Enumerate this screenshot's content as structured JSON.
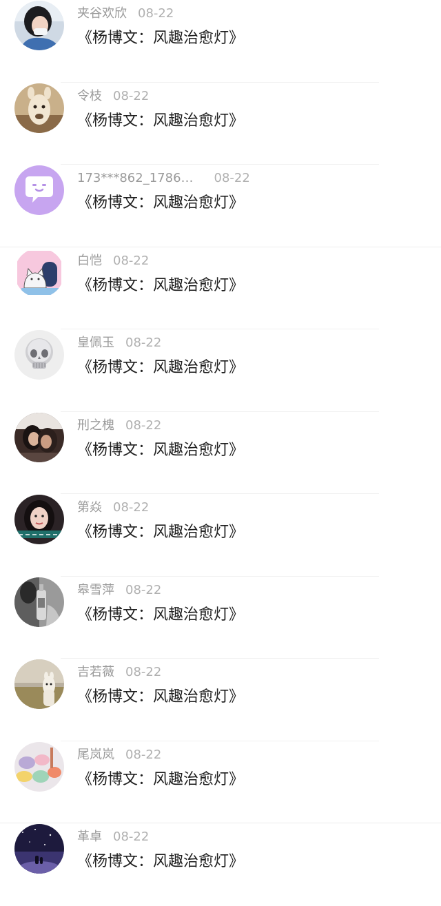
{
  "comments": [
    {
      "username": "夹谷欢欣",
      "date": "08-22",
      "title": "《杨博文：风趣治愈灯》",
      "avatar_icon": "girl-with-mask-avatar"
    },
    {
      "username": "令枝",
      "date": "08-22",
      "title": "《杨博文：风趣治愈灯》",
      "avatar_icon": "alpaca-avatar"
    },
    {
      "username": "173***862_1786…",
      "date": "08-22",
      "title": "《杨博文：风趣治愈灯》",
      "avatar_icon": "default-chat-bubble-avatar"
    },
    {
      "username": "白恺",
      "date": "08-22",
      "title": "《杨博文：风趣治愈灯》",
      "avatar_icon": "cartoon-cat-avatar"
    },
    {
      "username": "皇佩玉",
      "date": "08-22",
      "title": "《杨博文：风趣治愈灯》",
      "avatar_icon": "crystal-skull-avatar"
    },
    {
      "username": "刑之槐",
      "date": "08-22",
      "title": "《杨博文：风趣治愈灯》",
      "avatar_icon": "couple-photo-avatar"
    },
    {
      "username": "第焱",
      "date": "08-22",
      "title": "《杨博文：风趣治愈灯》",
      "avatar_icon": "girl-portrait-avatar"
    },
    {
      "username": "皋雪萍",
      "date": "08-22",
      "title": "《杨博文：风趣治愈灯》",
      "avatar_icon": "grayscale-bottle-avatar"
    },
    {
      "username": "吉若薇",
      "date": "08-22",
      "title": "《杨博文：风趣治愈灯》",
      "avatar_icon": "alpaca-field-avatar"
    },
    {
      "username": "尾岚岚",
      "date": "08-22",
      "title": "《杨博文：风趣治愈灯》",
      "avatar_icon": "candy-avatar"
    },
    {
      "username": "革卓",
      "date": "08-22",
      "title": "《杨博文：风趣治愈灯》",
      "avatar_icon": "starry-night-avatar"
    }
  ]
}
